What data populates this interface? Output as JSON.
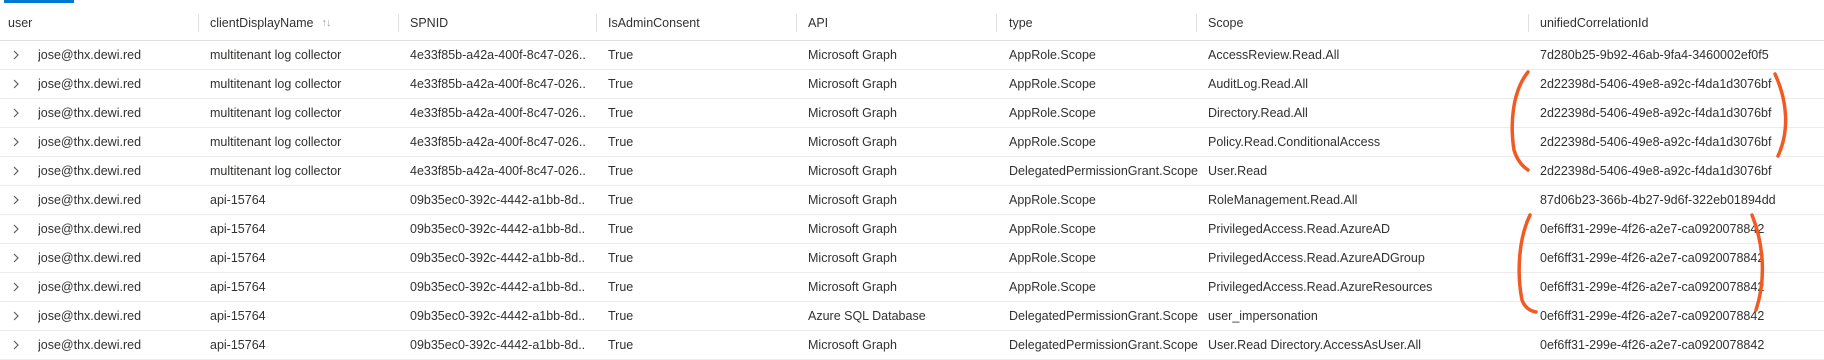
{
  "columns": [
    "user",
    "clientDisplayName",
    "SPNID",
    "IsAdminConsent",
    "API",
    "type",
    "Scope",
    "unifiedCorrelationId"
  ],
  "sort_icon": "↑↓",
  "annotation_color": "#f15a22",
  "rows": [
    {
      "user": "jose@thx.dewi.red",
      "client": "multitenant log collector",
      "spnid": "4e33f85b-a42a-400f-8c47-026...",
      "admin": "True",
      "api": "Microsoft Graph",
      "type": "AppRole.Scope",
      "scope": "AccessReview.Read.All",
      "corr": "7d280b25-9b92-46ab-9fa4-3460002ef0f5"
    },
    {
      "user": "jose@thx.dewi.red",
      "client": "multitenant log collector",
      "spnid": "4e33f85b-a42a-400f-8c47-026...",
      "admin": "True",
      "api": "Microsoft Graph",
      "type": "AppRole.Scope",
      "scope": "AuditLog.Read.All",
      "corr": "2d22398d-5406-49e8-a92c-f4da1d3076bf"
    },
    {
      "user": "jose@thx.dewi.red",
      "client": "multitenant log collector",
      "spnid": "4e33f85b-a42a-400f-8c47-026...",
      "admin": "True",
      "api": "Microsoft Graph",
      "type": "AppRole.Scope",
      "scope": "Directory.Read.All",
      "corr": "2d22398d-5406-49e8-a92c-f4da1d3076bf"
    },
    {
      "user": "jose@thx.dewi.red",
      "client": "multitenant log collector",
      "spnid": "4e33f85b-a42a-400f-8c47-026...",
      "admin": "True",
      "api": "Microsoft Graph",
      "type": "AppRole.Scope",
      "scope": "Policy.Read.ConditionalAccess",
      "corr": "2d22398d-5406-49e8-a92c-f4da1d3076bf"
    },
    {
      "user": "jose@thx.dewi.red",
      "client": "multitenant log collector",
      "spnid": "4e33f85b-a42a-400f-8c47-026...",
      "admin": "True",
      "api": "Microsoft Graph",
      "type": "DelegatedPermissionGrant.Scope",
      "scope": "User.Read",
      "corr": "2d22398d-5406-49e8-a92c-f4da1d3076bf"
    },
    {
      "user": "jose@thx.dewi.red",
      "client": "api-15764",
      "spnid": "09b35ec0-392c-4442-a1bb-8d...",
      "admin": "True",
      "api": "Microsoft Graph",
      "type": "AppRole.Scope",
      "scope": "RoleManagement.Read.All",
      "corr": "87d06b23-366b-4b27-9d6f-322eb01894dd"
    },
    {
      "user": "jose@thx.dewi.red",
      "client": "api-15764",
      "spnid": "09b35ec0-392c-4442-a1bb-8d...",
      "admin": "True",
      "api": "Microsoft Graph",
      "type": "AppRole.Scope",
      "scope": "PrivilegedAccess.Read.AzureAD",
      "corr": "0ef6ff31-299e-4f26-a2e7-ca0920078842"
    },
    {
      "user": "jose@thx.dewi.red",
      "client": "api-15764",
      "spnid": "09b35ec0-392c-4442-a1bb-8d...",
      "admin": "True",
      "api": "Microsoft Graph",
      "type": "AppRole.Scope",
      "scope": "PrivilegedAccess.Read.AzureADGroup",
      "corr": "0ef6ff31-299e-4f26-a2e7-ca0920078842"
    },
    {
      "user": "jose@thx.dewi.red",
      "client": "api-15764",
      "spnid": "09b35ec0-392c-4442-a1bb-8d...",
      "admin": "True",
      "api": "Microsoft Graph",
      "type": "AppRole.Scope",
      "scope": "PrivilegedAccess.Read.AzureResources",
      "corr": "0ef6ff31-299e-4f26-a2e7-ca0920078842"
    },
    {
      "user": "jose@thx.dewi.red",
      "client": "api-15764",
      "spnid": "09b35ec0-392c-4442-a1bb-8d...",
      "admin": "True",
      "api": "Azure SQL Database",
      "type": "DelegatedPermissionGrant.Scope",
      "scope": "user_impersonation",
      "corr": "0ef6ff31-299e-4f26-a2e7-ca0920078842"
    },
    {
      "user": "jose@thx.dewi.red",
      "client": "api-15764",
      "spnid": "09b35ec0-392c-4442-a1bb-8d...",
      "admin": "True",
      "api": "Microsoft Graph",
      "type": "DelegatedPermissionGrant.Scope",
      "scope": "User.Read Directory.AccessAsUser.All",
      "corr": "0ef6ff31-299e-4f26-a2e7-ca0920078842"
    }
  ]
}
